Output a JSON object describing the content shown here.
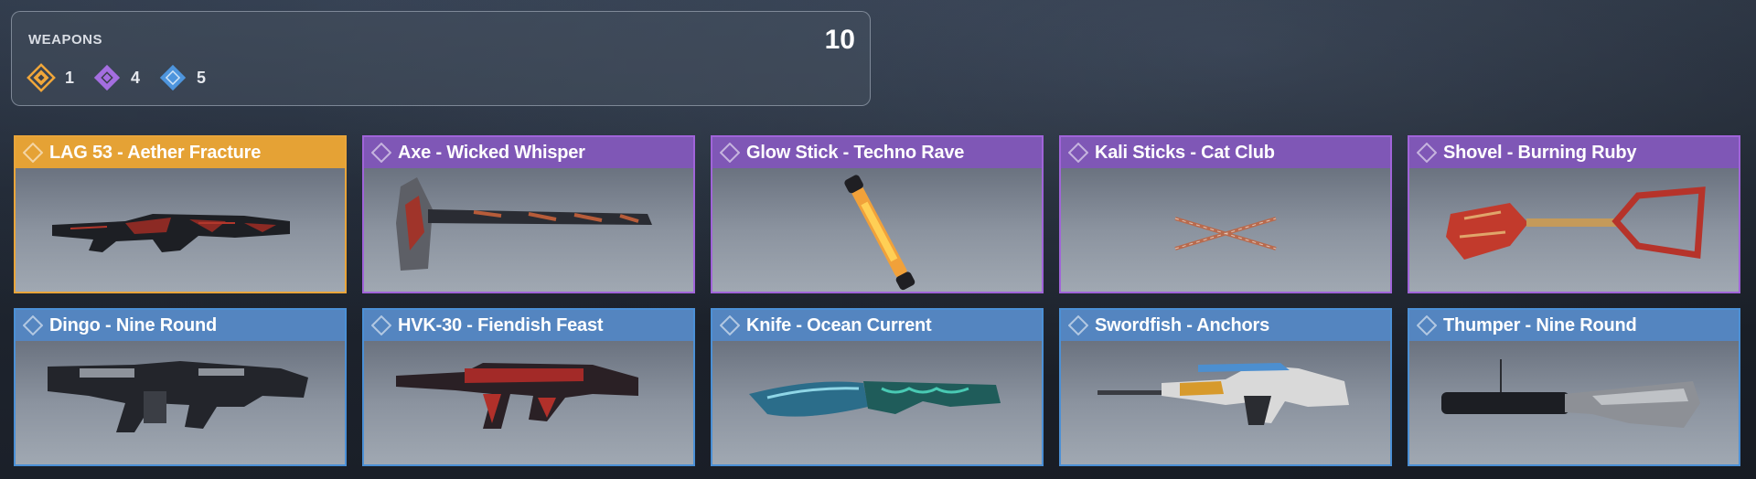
{
  "summary": {
    "title": "WEAPONS",
    "total": "10",
    "counts": [
      {
        "rarity": "legendary",
        "icon": "legendary-rarity-icon",
        "color": "#f1a73a",
        "count": "1"
      },
      {
        "rarity": "epic",
        "icon": "epic-rarity-icon",
        "color": "#a46ee0",
        "count": "4"
      },
      {
        "rarity": "rare",
        "icon": "rare-rarity-icon",
        "color": "#4e95dd",
        "count": "5"
      }
    ]
  },
  "colors": {
    "legendary": "#e5a235",
    "epic": "#7f57b6",
    "rare": "#5485c0"
  },
  "items": [
    {
      "name": "LAG 53 - Aether Fracture",
      "rarity": "legendary",
      "icon": "assault-rifle-icon"
    },
    {
      "name": "Axe - Wicked Whisper",
      "rarity": "epic",
      "icon": "axe-icon"
    },
    {
      "name": "Glow Stick - Techno Rave",
      "rarity": "epic",
      "icon": "glow-stick-icon"
    },
    {
      "name": "Kali Sticks - Cat Club",
      "rarity": "epic",
      "icon": "kali-sticks-icon"
    },
    {
      "name": "Shovel - Burning Ruby",
      "rarity": "epic",
      "icon": "shovel-icon"
    },
    {
      "name": "Dingo - Nine Round",
      "rarity": "rare",
      "icon": "light-machine-gun-icon"
    },
    {
      "name": "HVK-30 - Fiendish Feast",
      "rarity": "rare",
      "icon": "assault-rifle-icon"
    },
    {
      "name": "Knife - Ocean Current",
      "rarity": "rare",
      "icon": "knife-icon"
    },
    {
      "name": "Swordfish - Anchors",
      "rarity": "rare",
      "icon": "battle-rifle-icon"
    },
    {
      "name": "Thumper - Nine Round",
      "rarity": "rare",
      "icon": "grenade-launcher-icon"
    }
  ]
}
